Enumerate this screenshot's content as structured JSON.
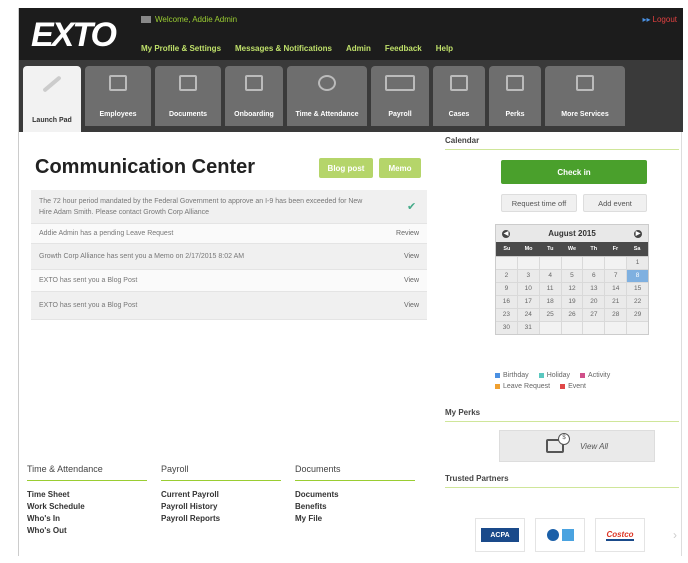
{
  "header": {
    "logo": "EXTO",
    "welcome": "Welcome, Addie Admin",
    "logout": "Logout",
    "nav": [
      "My Profile & Settings",
      "Messages & Notifications",
      "Admin",
      "Feedback",
      "Help"
    ]
  },
  "tabs": [
    {
      "label": "Launch Pad",
      "icon": "pencil-icon"
    },
    {
      "label": "Employees",
      "icon": "people-icon"
    },
    {
      "label": "Documents",
      "icon": "document-icon"
    },
    {
      "label": "Onboarding",
      "icon": "onboarding-icon"
    },
    {
      "label": "Time & Attendance",
      "icon": "clock-icon"
    },
    {
      "label": "Payroll",
      "icon": "payroll-icon"
    },
    {
      "label": "Cases",
      "icon": "cases-icon"
    },
    {
      "label": "Perks",
      "icon": "perks-icon"
    },
    {
      "label": "More Services",
      "icon": "services-icon"
    }
  ],
  "comm": {
    "title": "Communication Center",
    "blog_button": "Blog post",
    "memo_button": "Memo",
    "messages": [
      {
        "text": "The 72 hour period mandated by the Federal Government to approve an I-9 has been exceeded for New Hire Adam Smith. Please contact Growth Corp Alliance",
        "action": ""
      },
      {
        "text": "Addie Admin has a pending Leave Request",
        "action": "Review"
      },
      {
        "text": "Growth Corp Alliance has sent you a Memo on 2/17/2015 8:02 AM",
        "action": "View"
      },
      {
        "text": "EXTO has sent you a Blog Post",
        "action": "View"
      },
      {
        "text": "EXTO has sent you a Blog Post",
        "action": "View"
      }
    ]
  },
  "linkcols": [
    {
      "title": "Time & Attendance",
      "links": [
        "Time Sheet",
        "Work Schedule",
        "Who's In",
        "Who's Out"
      ]
    },
    {
      "title": "Payroll",
      "links": [
        "Current Payroll",
        "Payroll History",
        "Payroll Reports"
      ]
    },
    {
      "title": "Documents",
      "links": [
        "Documents",
        "Benefits",
        "My File"
      ]
    }
  ],
  "calendar": {
    "section_title": "Calendar",
    "checkin": "Check in",
    "request_time_off": "Request time off",
    "add_event": "Add event",
    "month": "August",
    "year": "2015",
    "dow": [
      "Su",
      "Mo",
      "Tu",
      "We",
      "Th",
      "Fr",
      "Sa"
    ],
    "weeks": [
      [
        "",
        "",
        "",
        "",
        "",
        "",
        "1"
      ],
      [
        "2",
        "3",
        "4",
        "5",
        "6",
        "7",
        "8"
      ],
      [
        "9",
        "10",
        "11",
        "12",
        "13",
        "14",
        "15"
      ],
      [
        "16",
        "17",
        "18",
        "19",
        "20",
        "21",
        "22"
      ],
      [
        "23",
        "24",
        "25",
        "26",
        "27",
        "28",
        "29"
      ],
      [
        "30",
        "31",
        "",
        "",
        "",
        "",
        ""
      ]
    ],
    "today": "8",
    "legend": [
      {
        "label": "Birthday",
        "color": "#4a90e2"
      },
      {
        "label": "Holiday",
        "color": "#5bc8c0"
      },
      {
        "label": "Activity",
        "color": "#d0508a"
      },
      {
        "label": "Leave Request",
        "color": "#f0a030"
      },
      {
        "label": "Event",
        "color": "#e04848"
      }
    ]
  },
  "perks": {
    "title": "My Perks",
    "view_all": "View All"
  },
  "partners": {
    "title": "Trusted Partners",
    "items": [
      "ACPA",
      "",
      "Costco"
    ]
  },
  "colors": {
    "header_bg": "#1c1c1c",
    "nav_link": "#bfe06a",
    "checkin": "#4aa02c",
    "blog_btn": "#b5d56a"
  }
}
